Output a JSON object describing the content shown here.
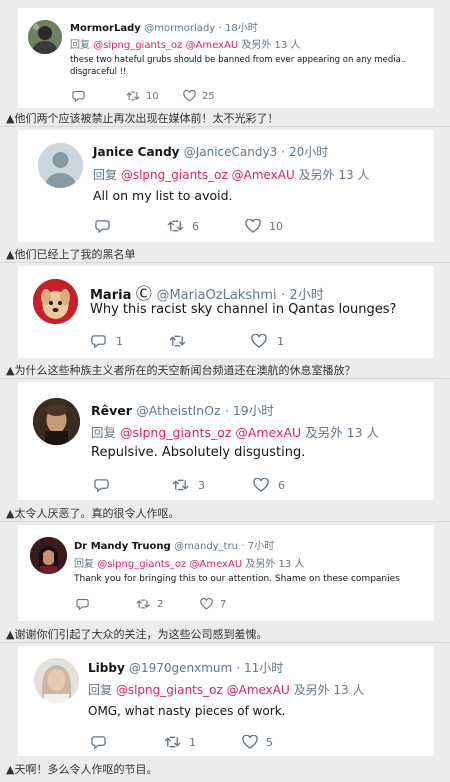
{
  "reply_label": "回复",
  "and_label": "及另外 13 人",
  "mention1": "@slpng_giants_oz",
  "mention2": "@AmexAU",
  "tweets": [
    {
      "name": "MormorLady",
      "handle": "@mormorlady",
      "time": "· 18小时",
      "body_lines": [
        "these two hateful grubs should be banned from ever appearing on any media..",
        "disgraceful !!"
      ],
      "retweets": "10",
      "likes": "25",
      "caption": "▲他们两个应该被禁止再次出现在媒体前！太不光彩了！"
    },
    {
      "name": "Janice Candy",
      "handle": "@JaniceCandy3",
      "time": "· 20小时",
      "body_lines": [
        "All on my list to avoid."
      ],
      "retweets": "6",
      "likes": "10",
      "caption": "▲他们已经上了我的黑名单"
    },
    {
      "name": "Maria",
      "name_symbol": "Ⓒ",
      "handle": "@MariaOzLakshmi",
      "time": "· 2小时",
      "body_lines": [
        "Why this racist sky channel in Qantas lounges?"
      ],
      "replies": "1",
      "likes": "1",
      "caption": "▲为什么这些种族主义者所在的天空新闻台频道还在澳航的休息室播放？"
    },
    {
      "name": "Rêver",
      "handle": "@AtheistInOz",
      "time": "· 19小时",
      "body_lines": [
        "Repulsive. Absolutely disgusting."
      ],
      "retweets": "3",
      "likes": "6",
      "caption": "▲太令人厌恶了。真的很令人作呕。"
    },
    {
      "name": "Dr Mandy Truong",
      "handle": "@mandy_tru",
      "time": "· 7小时",
      "body_lines": [
        "Thank you for bringing this to our attention.  Shame on these companies"
      ],
      "retweets": "2",
      "likes": "7",
      "caption": "▲谢谢你们引起了大众的关注，为这些公司感到羞愧。"
    },
    {
      "name": "Libby",
      "handle": "@1970genxmum",
      "time": "· 11小时",
      "body_lines": [
        "OMG, what nasty pieces of work."
      ],
      "retweets": "1",
      "likes": "5",
      "caption": "▲天啊！多么令人作呕的节目。"
    }
  ],
  "colors": {
    "mention": "#e0245e",
    "muted": "#657786",
    "text": "#14171a",
    "background": "#ececec"
  }
}
